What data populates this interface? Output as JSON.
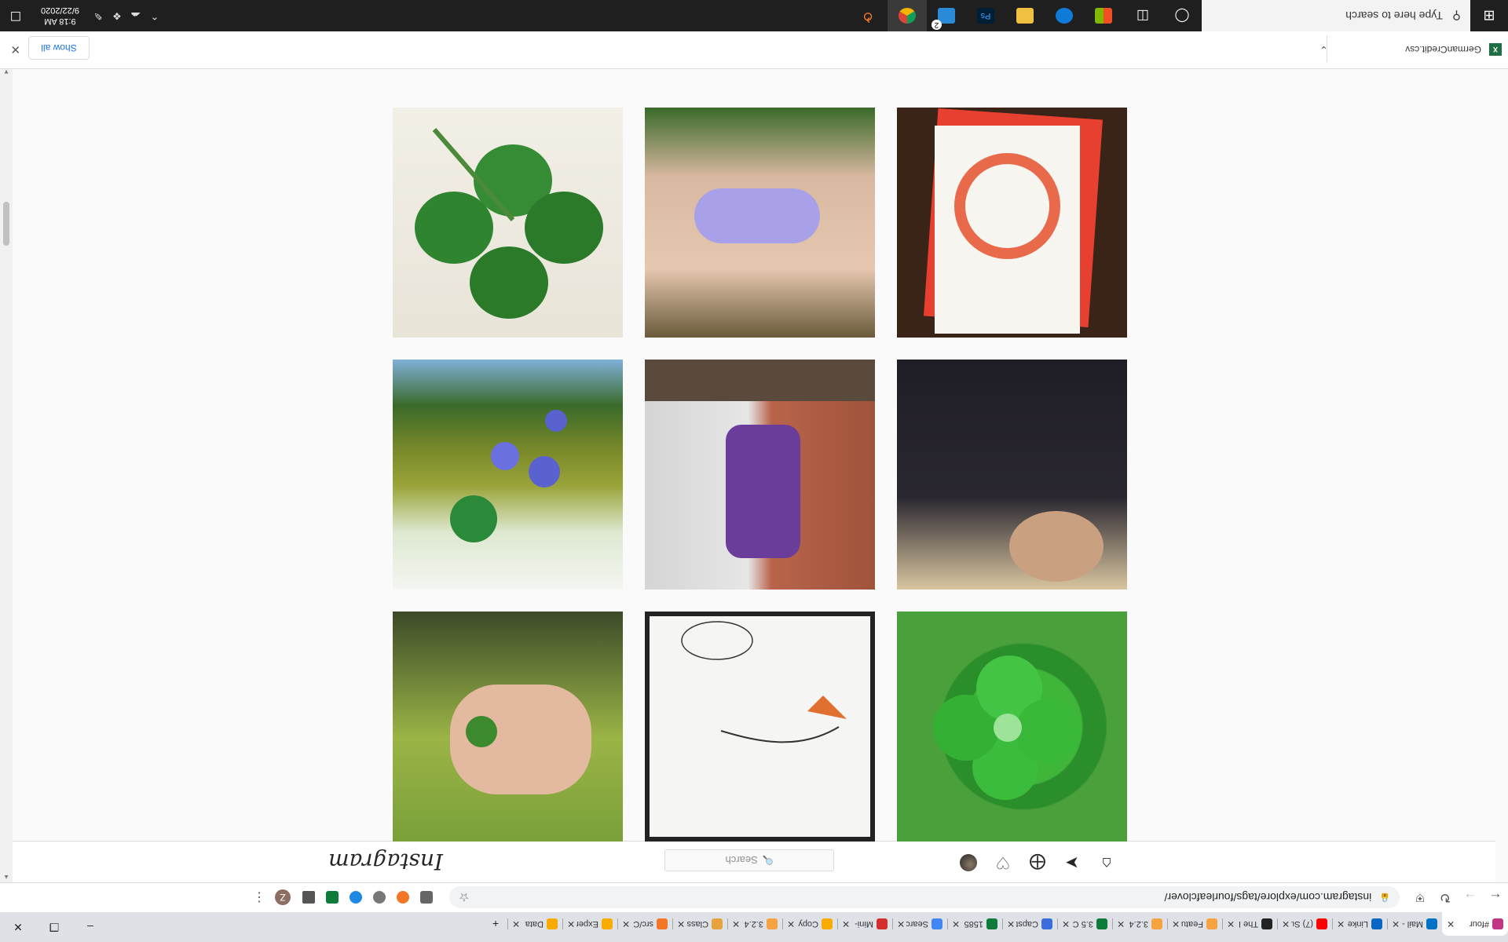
{
  "browser": {
    "tabs": [
      {
        "title": "#four",
        "color": "#c13584",
        "active": true
      },
      {
        "title": "Mail -",
        "color": "#0072c6"
      },
      {
        "title": "Linke",
        "color": "#0a66c2"
      },
      {
        "title": "(7) Su",
        "color": "#ff0000"
      },
      {
        "title": "The I",
        "color": "#222222"
      },
      {
        "title": "Featu",
        "color": "#f4a340"
      },
      {
        "title": "3.2.4",
        "color": "#f4a340"
      },
      {
        "title": "3.5 C",
        "color": "#0d7c3a"
      },
      {
        "title": "Capst",
        "color": "#3b6edc"
      },
      {
        "title": "1585",
        "color": "#0d7c3a"
      },
      {
        "title": "Searc",
        "color": "#4285f4"
      },
      {
        "title": "Mini-",
        "color": "#d32f2f"
      },
      {
        "title": "Copy",
        "color": "#f9ab00"
      },
      {
        "title": "3.2.4",
        "color": "#f4a340"
      },
      {
        "title": "Class",
        "color": "#e6a23c"
      },
      {
        "title": "src/C",
        "color": "#f37626"
      },
      {
        "title": "Exper",
        "color": "#f9ab00"
      },
      {
        "title": "Data",
        "color": "#f9ab00"
      }
    ],
    "url": "instagram.com/explore/tags/fourleafclover/",
    "avatar_letter": "Z"
  },
  "instagram": {
    "logo": "Instagram",
    "search_placeholder": "Search"
  },
  "downloads": {
    "filename": "GermanCredit.csv",
    "show_all": "Show all"
  },
  "taskbar": {
    "search_placeholder": "Type here to search",
    "time": "9:18 AM",
    "date": "9/22/2020",
    "photoshop_label": "Ps",
    "notification_badge": "2"
  }
}
